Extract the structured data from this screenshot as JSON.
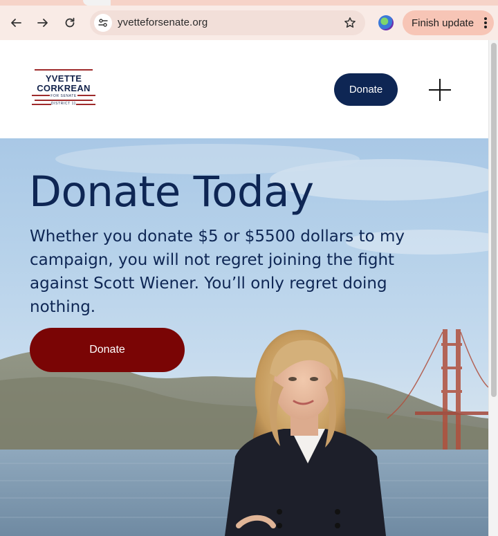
{
  "browser": {
    "url": "yvetteforsenate.org",
    "finish_update_label": "Finish update",
    "icons": {
      "back": "back-arrow-icon",
      "forward": "forward-arrow-icon",
      "reload": "reload-icon",
      "site_info": "tune-icon",
      "bookmark": "star-icon",
      "profile": "profile-avatar",
      "menu": "kebab-menu-icon"
    },
    "colors": {
      "tabstrip": "#f6d3c8",
      "toolbar": "#f9ebe6",
      "finish_update": "#f7c5b6"
    }
  },
  "header": {
    "logo": {
      "line1": "YVETTE",
      "line2": "CORKREAN",
      "line3": "FOR SENATE",
      "line4": "DISTRICT 11"
    },
    "donate_label": "Donate",
    "menu_icon": "plus-icon"
  },
  "hero": {
    "title": "Donate Today",
    "body": "Whether you donate $5 or $5500 dollars to my campaign, you will not regret joining the fight against Scott Wiener. You’ll only regret doing nothing.",
    "donate_label": "Donate"
  },
  "colors": {
    "navy": "#0e2654",
    "donate_red": "#7a0505",
    "logo_red": "#9e2a2b"
  }
}
